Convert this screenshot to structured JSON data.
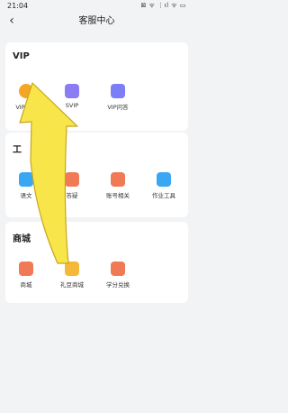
{
  "status_bar": {
    "time": "21:04",
    "indicators": "⊠ ᯤ ⋮ıl ᯤ ▭"
  },
  "navbar": {
    "back_icon": "chevron-left-icon",
    "title": "客服中心"
  },
  "sections": [
    {
      "title": "VIP",
      "items": [
        {
          "label": "VIP会员",
          "icon": "vip-crown-icon",
          "color": "#f5a623"
        },
        {
          "label": "SVIP",
          "icon": "svip-crown-icon",
          "color": "#8a7cf2"
        },
        {
          "label": "VIP问答",
          "icon": "vip-message-icon",
          "color": "#7b7ef6"
        }
      ]
    },
    {
      "title": "工",
      "items": [
        {
          "label": "语文",
          "icon": "chinese-icon",
          "color": "#3aa7f3"
        },
        {
          "label": "答疑",
          "icon": "qa-icon",
          "color": "#f07a55"
        },
        {
          "label": "账号相关",
          "icon": "account-icon",
          "color": "#f07a55"
        },
        {
          "label": "作业工具",
          "icon": "homework-tool-icon",
          "color": "#3aa7f3"
        }
      ]
    },
    {
      "title": "商城",
      "items": [
        {
          "label": "商城",
          "icon": "mall-icon",
          "color": "#f07a55"
        },
        {
          "label": "礼豆商城",
          "icon": "gift-bean-mall-icon",
          "color": "#f5b93a"
        },
        {
          "label": "学分兑换",
          "icon": "credit-exchange-icon",
          "color": "#f07a55"
        }
      ]
    }
  ],
  "overlay": {
    "arrow_color": "#f7e54a"
  }
}
